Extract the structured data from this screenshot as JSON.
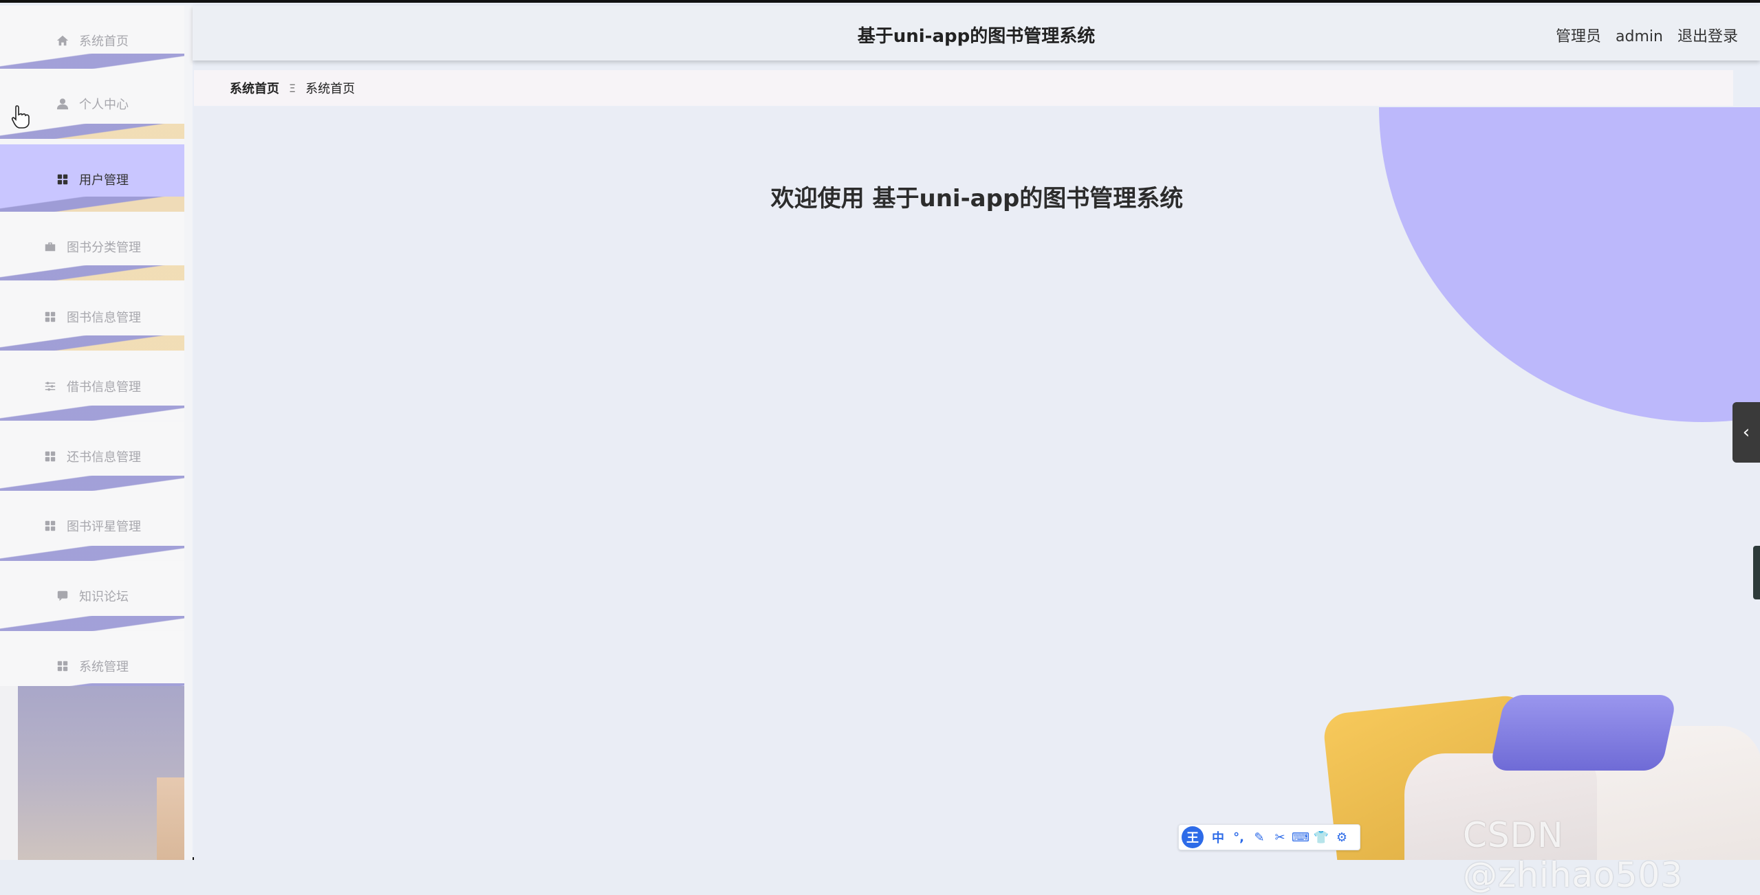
{
  "header": {
    "title": "基于uni-app的图书管理系统",
    "role": "管理员",
    "username": "admin",
    "logout_label": "退出登录"
  },
  "sidebar": {
    "items": [
      {
        "label": "系统首页",
        "icon": "home-icon"
      },
      {
        "label": "个人中心",
        "icon": "user-icon"
      },
      {
        "label": "用户管理",
        "icon": "grid-icon",
        "active": true
      },
      {
        "label": "图书分类管理",
        "icon": "briefcase-icon"
      },
      {
        "label": "图书信息管理",
        "icon": "grid-icon"
      },
      {
        "label": "借书信息管理",
        "icon": "sliders-icon"
      },
      {
        "label": "还书信息管理",
        "icon": "grid-icon"
      },
      {
        "label": "图书评星管理",
        "icon": "grid-icon"
      },
      {
        "label": "知识论坛",
        "icon": "chat-icon"
      },
      {
        "label": "系统管理",
        "icon": "grid-icon"
      }
    ]
  },
  "breadcrumb": {
    "home": "系统首页",
    "separator": "Ξ",
    "current": "系统首页"
  },
  "main": {
    "welcome": "欢迎使用 基于uni-app的图书管理系统"
  },
  "ime_toolbar": {
    "logo": "王",
    "tools": [
      "中",
      "°,",
      "✎",
      "✂",
      "⌨",
      "👕",
      "⚙"
    ]
  },
  "watermark": "CSDN @zhihao503",
  "colors": {
    "active_menu": "#c9c6ff",
    "accent_circle": "#bcb8fb",
    "stripe": "#9e9cd6"
  }
}
